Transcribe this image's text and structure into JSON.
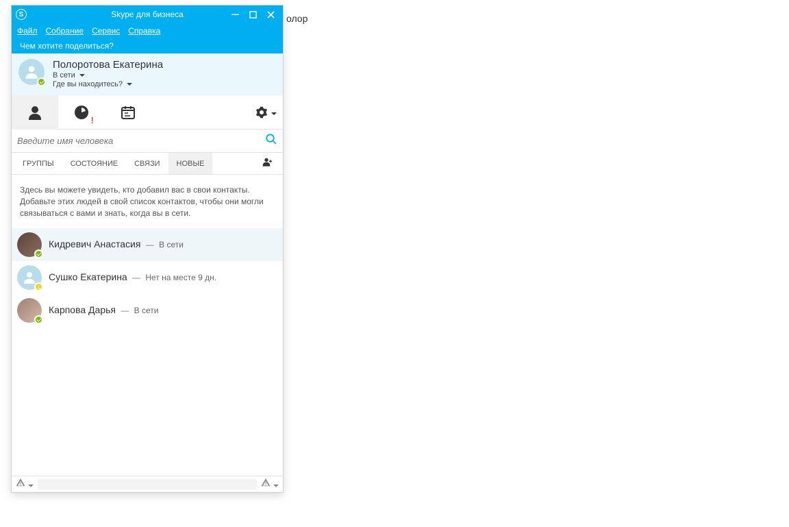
{
  "background_text": "олор",
  "window": {
    "title": "Skype для бизнеса",
    "menu": {
      "file": "Файл",
      "meeting": "Собрание",
      "tools": "Сервис",
      "help": "Справка"
    },
    "share_prompt": "Чем хотите поделиться?"
  },
  "me": {
    "name": "Полоротова Екатерина",
    "status": "В сети",
    "location": "Где вы находитесь?"
  },
  "search": {
    "placeholder": "Введите имя человека"
  },
  "filters": {
    "groups": "ГРУППЫ",
    "status": "СОСТОЯНИЕ",
    "relations": "СВЯЗИ",
    "new": "НОВЫЕ"
  },
  "info_text": "Здесь вы можете увидеть, кто добавил вас в свои контакты. Добавьте этих людей в свой список контактов, чтобы они могли связываться с вами и знать, когда вы в сети.",
  "contacts": [
    {
      "name": "Кидревич Анастасия",
      "status_text": "В сети",
      "status": "online",
      "photo": true,
      "photoClass": "photo1",
      "highlight": true
    },
    {
      "name": "Сушко Екатерина",
      "status_text": "Нет на месте 9 дн.",
      "status": "away",
      "photo": false,
      "highlight": false
    },
    {
      "name": "Карпова Дарья",
      "status_text": "В сети",
      "status": "online",
      "photo": true,
      "photoClass": "photo2",
      "highlight": false
    }
  ],
  "separator": "—"
}
